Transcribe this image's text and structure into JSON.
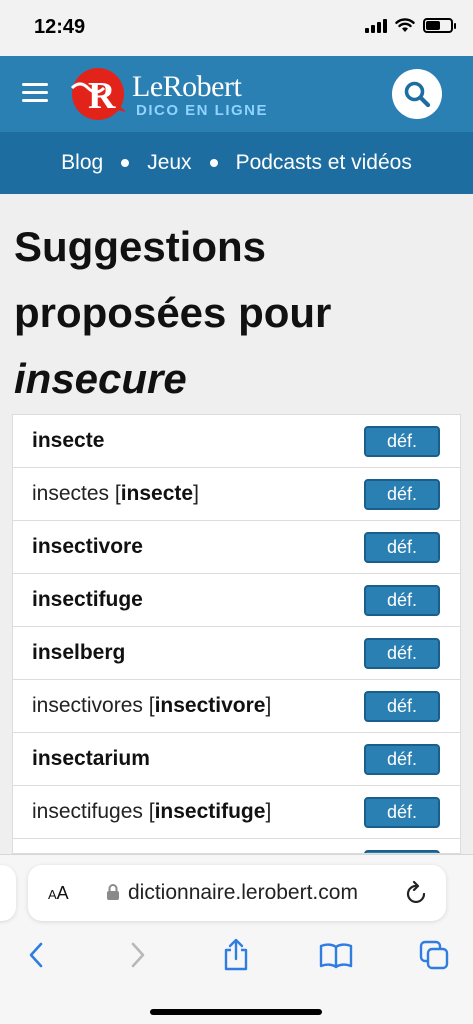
{
  "status": {
    "time": "12:49",
    "battery_level": 0.6
  },
  "header": {
    "logo_name": "LeRobert",
    "logo_sub": "DICO EN LIGNE",
    "brand_color": "#2a7fb3",
    "nav_color": "#1d6da1",
    "menu_icon": "hamburger-icon",
    "search_icon": "search-icon"
  },
  "nav": {
    "items": [
      {
        "label": "Blog"
      },
      {
        "label": "Jeux"
      },
      {
        "label": "Podcasts et vidéos"
      }
    ]
  },
  "title": {
    "line1": "Suggestions",
    "line2": "proposées pour",
    "query": "insecure"
  },
  "results": {
    "button_label": "déf.",
    "items": [
      {
        "word": "insecte",
        "base": ""
      },
      {
        "word": "insectes",
        "base": "insecte"
      },
      {
        "word": "insectivore",
        "base": ""
      },
      {
        "word": "insectifuge",
        "base": ""
      },
      {
        "word": "inselberg",
        "base": ""
      },
      {
        "word": "insectivores",
        "base": "insectivore"
      },
      {
        "word": "insectarium",
        "base": ""
      },
      {
        "word": "insectifuges",
        "base": "insectifuge"
      }
    ]
  },
  "browser": {
    "aa_label": "AA",
    "url": "dictionnaire.lerobert.com",
    "icons": [
      "back-icon",
      "forward-icon",
      "share-icon",
      "bookmarks-icon",
      "tabs-icon"
    ]
  }
}
